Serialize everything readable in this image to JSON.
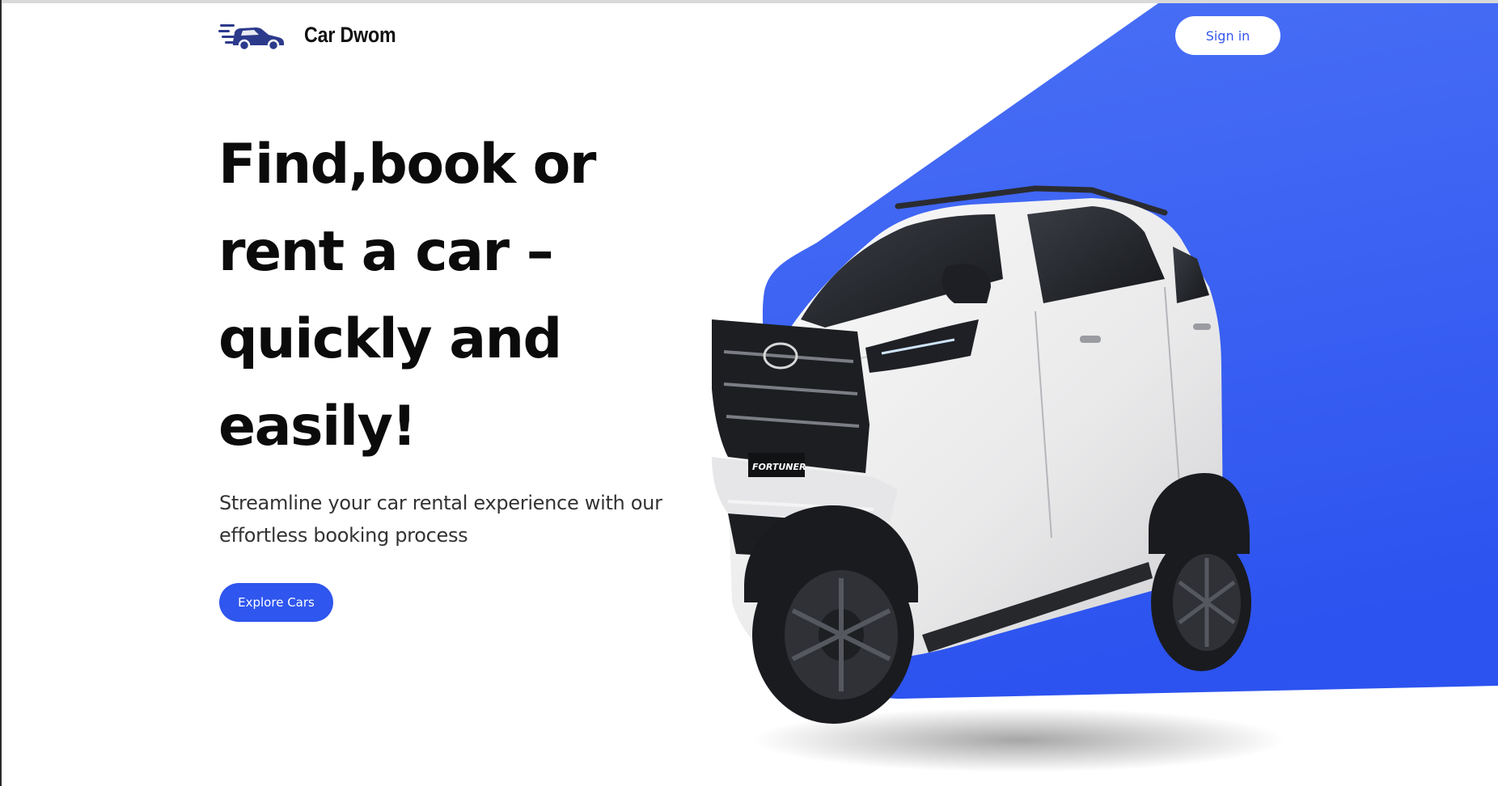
{
  "brand": {
    "name": "Car Dwom",
    "logo_icon": "speeding-car-icon"
  },
  "header": {
    "signin_label": "Sign in"
  },
  "hero": {
    "title": "Find,book or rent a car – quickly and easily!",
    "subtitle": "Streamline your car rental experience with our effortless booking process",
    "cta_label": "Explore Cars"
  },
  "car": {
    "plate_text": "FORTUNER"
  },
  "colors": {
    "accent": "#2f56ee",
    "gradient_top": "#4a6ff5",
    "gradient_bottom": "#2e55f0",
    "text_dark": "#0b0b0b"
  }
}
